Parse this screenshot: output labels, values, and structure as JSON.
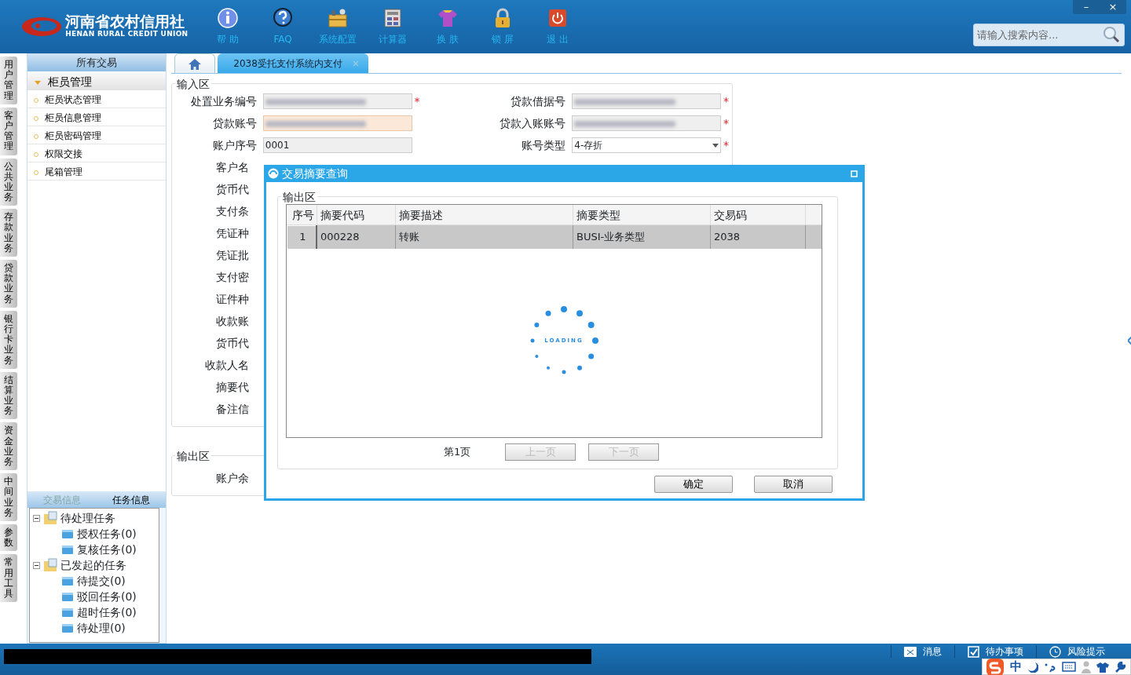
{
  "header": {
    "logo_cn": "河南省农村信用社",
    "logo_en": "HENAN RURAL CREDIT UNION",
    "tools": [
      "帮 助",
      "FAQ",
      "系统配置",
      "计算器",
      "换 肤",
      "锁 屏",
      "退 出"
    ],
    "window_buttons": [
      "–",
      "×"
    ],
    "search": {
      "placeholder": "请输入搜索内容..."
    }
  },
  "side_tabs": [
    "用户管理",
    "客户管理",
    "公共业务",
    "存款业务",
    "贷款业务",
    "银行卡业务",
    "结算业务",
    "资金业务",
    "中间业务",
    "参数",
    "常用工具"
  ],
  "menu": {
    "title": "所有交易",
    "group": {
      "label": "柜员管理",
      "expanded": true
    },
    "items": [
      "柜员状态管理",
      "柜员信息管理",
      "柜员密码管理",
      "权限交接",
      "尾箱管理"
    ]
  },
  "info_tabs": [
    {
      "label": "交易信息",
      "selected": false
    },
    {
      "label": "任务信息",
      "selected": true
    }
  ],
  "task_tree": [
    {
      "label": "待处理任务",
      "expanded": true,
      "children": [
        {
          "label": "授权任务(0)"
        },
        {
          "label": "复核任务(0)"
        }
      ]
    },
    {
      "label": "已发起的任务",
      "expanded": true,
      "children": [
        {
          "label": "待提交(0)"
        },
        {
          "label": "驳回任务(0)"
        },
        {
          "label": "超时任务(0)"
        },
        {
          "label": "待处理(0)"
        }
      ]
    }
  ],
  "tabs": [
    {
      "kind": "home",
      "selected": false
    },
    {
      "kind": "page",
      "label": "2038受托支付系统内支付",
      "selected": true
    }
  ],
  "input_section": {
    "title": "输入区",
    "rows": [
      {
        "left": {
          "label": "处置业务编号",
          "redacted": true,
          "mark": "*",
          "focused": false
        },
        "right": {
          "label": "贷款借据号",
          "redacted": true,
          "mark": "*"
        }
      },
      {
        "left": {
          "label": "贷款账号",
          "redacted": true,
          "focused": true
        },
        "right": {
          "label": "贷款入账账号",
          "redacted": true,
          "mark": "*"
        }
      },
      {
        "left": {
          "label": "账户序号",
          "value": "0001",
          "redacted": false,
          "focused": false
        },
        "right": {
          "label": "账号类型",
          "value": "4-存折",
          "kind": "select",
          "redacted": false,
          "mark": "*"
        }
      }
    ],
    "labels": [
      "客户名",
      "货币代",
      "支付条",
      "凭证种",
      "凭证批",
      "支付密",
      "证件种",
      "收款账",
      "货币代",
      "收款人名",
      "摘要代",
      "备注信"
    ]
  },
  "output_section": {
    "title": "输出区",
    "labels": [
      "账户余"
    ]
  },
  "dialog": {
    "title": "交易摘要查询",
    "section": "输出区",
    "columns": [
      "序号",
      "摘要代码",
      "摘要描述",
      "摘要类型",
      "交易码"
    ],
    "rows": [
      {
        "cells": [
          "1",
          "000228",
          "转账",
          "BUSI-业务类型",
          "2038"
        ],
        "selected": true
      }
    ],
    "loading": "LOADING",
    "page": "第1页",
    "pager": [
      {
        "label": "上一页",
        "disabled": true
      },
      {
        "label": "下一页",
        "disabled": true
      }
    ],
    "buttons": [
      "确定",
      "取消"
    ]
  },
  "status_bar": {
    "items": [
      "消息",
      "待办事项",
      "风险提示"
    ],
    "ime": "中"
  }
}
